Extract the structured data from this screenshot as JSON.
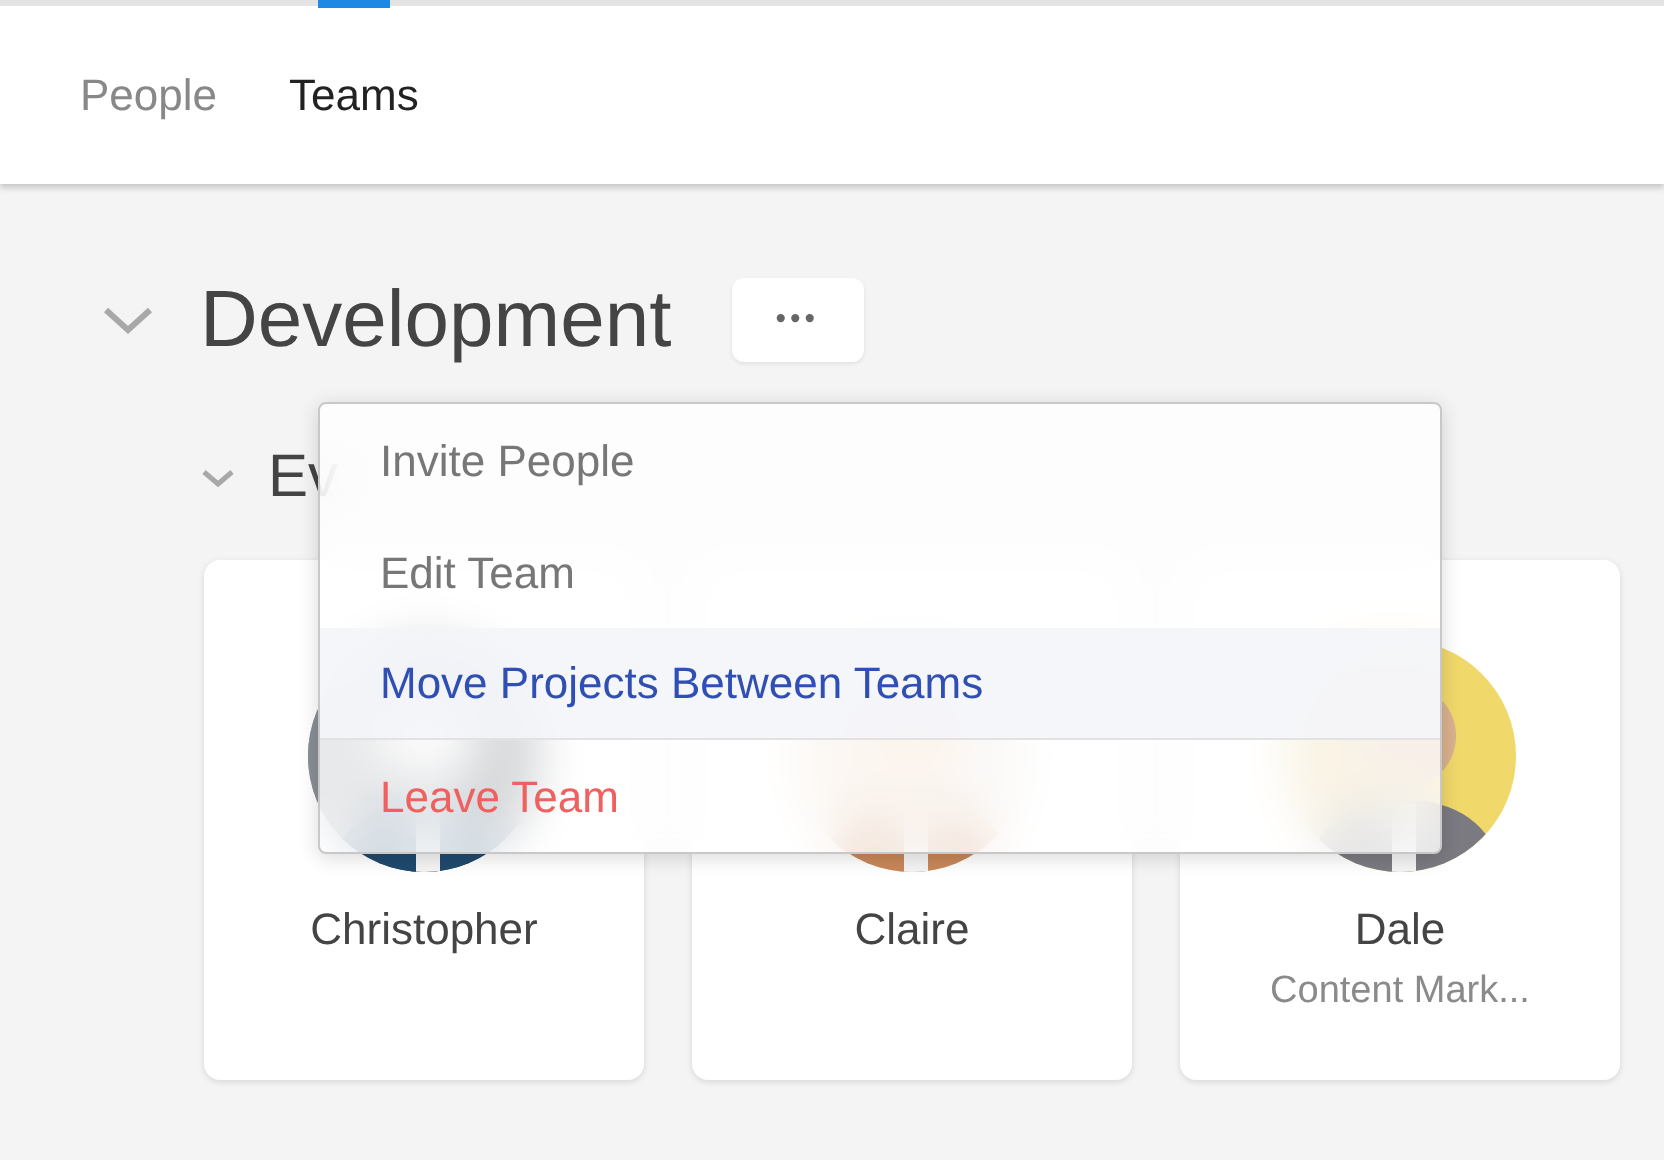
{
  "tabs": [
    {
      "label": "People",
      "selected": false
    },
    {
      "label": "Teams",
      "selected": true
    }
  ],
  "team": {
    "name": "Development",
    "expanded": true,
    "menu_button": "•••"
  },
  "subteam": {
    "name": "Ev",
    "expanded": true
  },
  "members": [
    {
      "name": "Christopher"
    },
    {
      "name": "Claire"
    },
    {
      "name": "Dale",
      "role": "Content Mark..."
    }
  ],
  "menu": [
    {
      "label": "Invite People",
      "kind": "default",
      "selected": false
    },
    {
      "label": "Edit Team",
      "kind": "default",
      "selected": false
    },
    {
      "label": "Move Projects Between Teams",
      "kind": "default",
      "selected": true
    },
    {
      "label": "Leave Team",
      "kind": "danger",
      "selected": false
    }
  ]
}
